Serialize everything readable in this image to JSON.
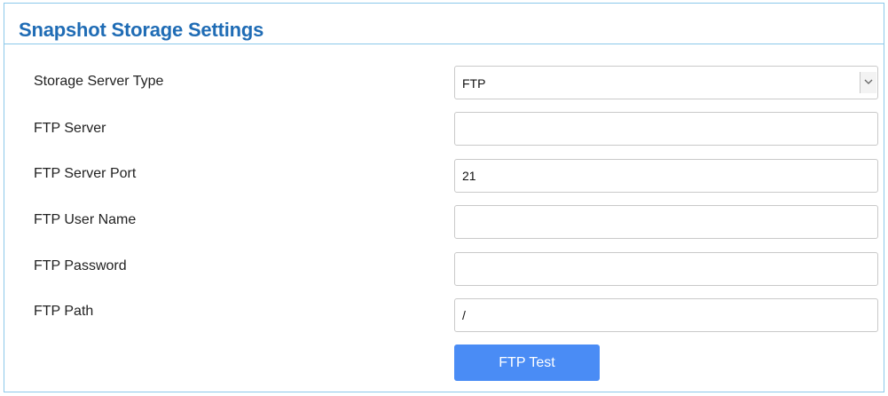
{
  "panel": {
    "title": "Snapshot Storage Settings"
  },
  "fields": {
    "storage_server_type": {
      "label": "Storage Server Type",
      "value": "FTP",
      "icon": "chevron-down-icon"
    },
    "ftp_server": {
      "label": "FTP Server",
      "value": ""
    },
    "ftp_server_port": {
      "label": "FTP Server Port",
      "value": "21"
    },
    "ftp_user_name": {
      "label": "FTP User Name",
      "value": ""
    },
    "ftp_password": {
      "label": "FTP Password",
      "value": ""
    },
    "ftp_path": {
      "label": "FTP Path",
      "value": "/"
    }
  },
  "actions": {
    "test_label": "FTP Test"
  },
  "colors": {
    "title": "#1f6cb5",
    "border": "#8cc8ea",
    "button": "#4a8cf5"
  }
}
